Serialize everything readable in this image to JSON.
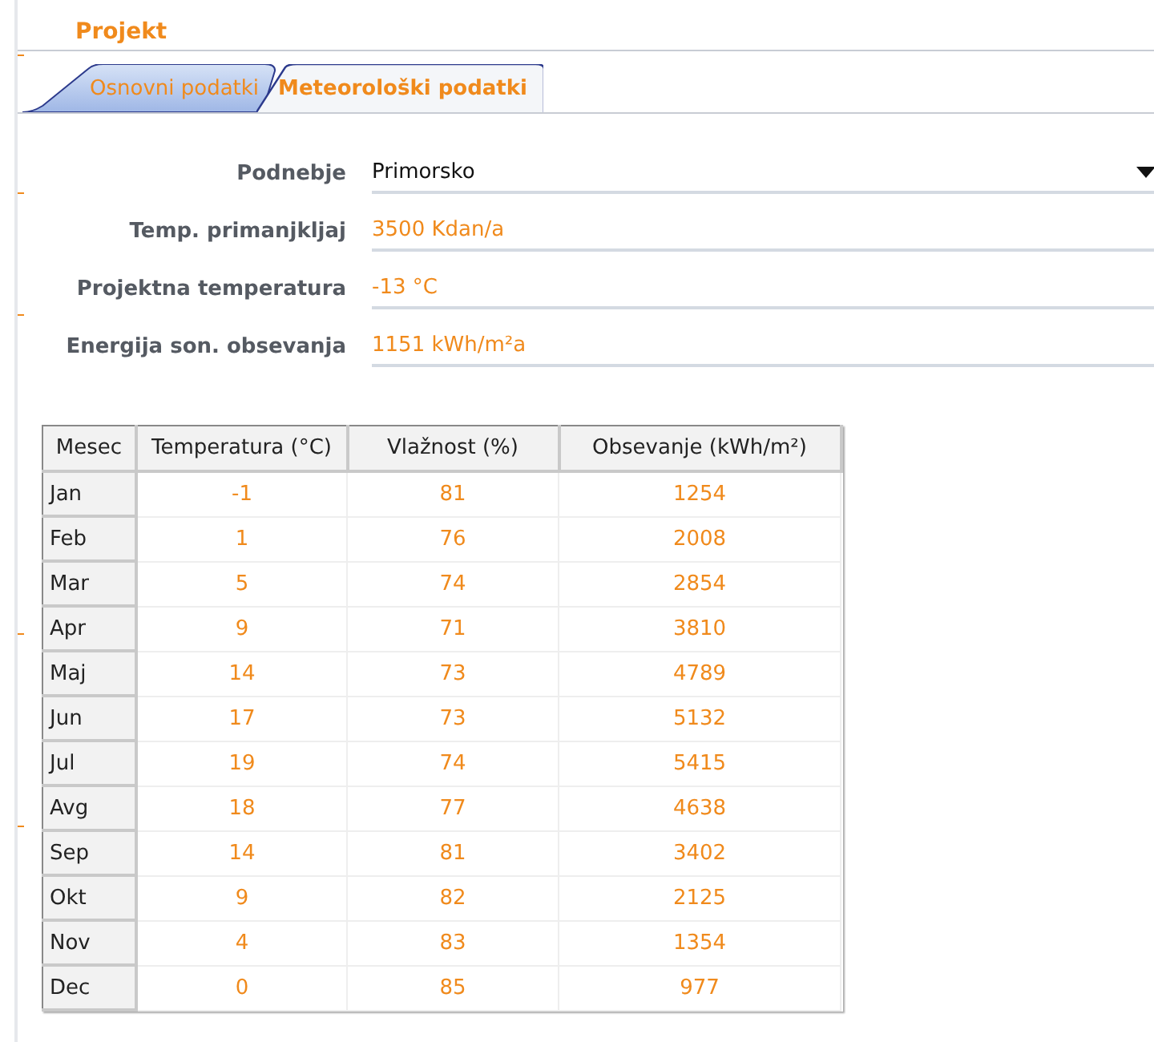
{
  "section_title": "Projekt",
  "tabs": [
    {
      "label": "Osnovni podatki",
      "selected": false
    },
    {
      "label": "Meteorološki podatki",
      "selected": true
    }
  ],
  "fields": [
    {
      "kind": "dropdown",
      "label": "Podnebje",
      "value": "Primorsko"
    },
    {
      "kind": "text",
      "label": "Temp. primanjkljaj",
      "value": "3500 Kdan/a"
    },
    {
      "kind": "text",
      "label": "Projektna temperatura",
      "value": "-13 °C"
    },
    {
      "kind": "text",
      "label": "Energija son. obsevanja",
      "value": "1151 kWh/m²a"
    }
  ],
  "table": {
    "columns": [
      "Mesec",
      "Temperatura (°C)",
      "Vlažnost (%)",
      "Obsevanje (kWh/m²)"
    ],
    "rows": [
      [
        "Jan",
        "-1",
        "81",
        "1254"
      ],
      [
        "Feb",
        "1",
        "76",
        "2008"
      ],
      [
        "Mar",
        "5",
        "74",
        "2854"
      ],
      [
        "Apr",
        "9",
        "71",
        "3810"
      ],
      [
        "Maj",
        "14",
        "73",
        "4789"
      ],
      [
        "Jun",
        "17",
        "73",
        "5132"
      ],
      [
        "Jul",
        "19",
        "74",
        "5415"
      ],
      [
        "Avg",
        "18",
        "77",
        "4638"
      ],
      [
        "Sep",
        "14",
        "81",
        "3402"
      ],
      [
        "Okt",
        "9",
        "82",
        "2125"
      ],
      [
        "Nov",
        "4",
        "83",
        "1354"
      ],
      [
        "Dec",
        "0",
        "85",
        "977"
      ]
    ]
  }
}
